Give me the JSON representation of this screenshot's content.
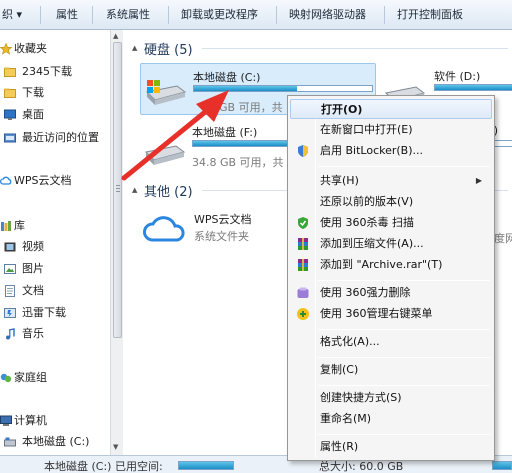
{
  "toolbar": {
    "items": [
      "织",
      "属性",
      "系统属性",
      "卸载或更改程序",
      "映射网络驱动器",
      "打开控制面板"
    ]
  },
  "nav": {
    "items": [
      {
        "label": "收藏夹",
        "icon": "star-icon"
      },
      {
        "label": "2345下载",
        "icon": "folder-icon"
      },
      {
        "label": "下载",
        "icon": "folder-icon"
      },
      {
        "label": "桌面",
        "icon": "desktop-icon"
      },
      {
        "label": "最近访问的位置",
        "icon": "recent-places-icon"
      },
      {
        "label": "WPS云文档",
        "icon": "cloud-icon"
      },
      {
        "label": "库",
        "icon": "library-icon"
      },
      {
        "label": "视频",
        "icon": "video-icon"
      },
      {
        "label": "图片",
        "icon": "picture-icon"
      },
      {
        "label": "文档",
        "icon": "document-icon"
      },
      {
        "label": "迅雷下载",
        "icon": "thunder-download-icon"
      },
      {
        "label": "音乐",
        "icon": "music-icon"
      },
      {
        "label": "家庭组",
        "icon": "homegroup-icon"
      },
      {
        "label": "计算机",
        "icon": "computer-icon"
      },
      {
        "label": "本地磁盘 (C:)",
        "icon": "drive-icon"
      }
    ]
  },
  "content": {
    "hdd_group": "硬盘 (5)",
    "other_group": "其他 (2)",
    "drives": [
      {
        "name": "本地磁盘 (C:)",
        "free_text": "GB 可用，共",
        "usage": 0.58
      },
      {
        "name": "软件 (D:)",
        "free_text": "",
        "usage": 0.9
      },
      {
        "name": "本地磁盘 (F:)",
        "free_text": "34.8 GB 可用，共",
        "usage": 0.62
      },
      {
        "name": ":)",
        "free_text": "",
        "usage": 0.5
      }
    ],
    "wps": {
      "name": "WPS云文档",
      "sub": "系统文件夹"
    },
    "right_cut_text": "度网"
  },
  "status": {
    "left": "本地磁盘 (C:) 已用空间:",
    "right": "总大小: 60.0 GB"
  },
  "context_menu": {
    "items": [
      {
        "label": "打开(O)",
        "bold": true,
        "highlighted": true,
        "icon": ""
      },
      {
        "label": "在新窗口中打开(E)",
        "icon": ""
      },
      {
        "label": "启用 BitLocker(B)...",
        "icon": "shield-icon"
      },
      {
        "label": "共享(H)",
        "submenu": true,
        "icon": ""
      },
      {
        "label": "还原以前的版本(V)",
        "icon": ""
      },
      {
        "label": "使用 360杀毒 扫描",
        "icon": "360-antivirus-icon"
      },
      {
        "label": "添加到压缩文件(A)...",
        "icon": "winrar-icon"
      },
      {
        "label": "添加到 \"Archive.rar\"(T)",
        "icon": "winrar-icon"
      },
      {
        "label": "使用 360强力删除",
        "icon": "360-delete-icon"
      },
      {
        "label": "使用 360管理右键菜单",
        "icon": "360-manager-icon"
      },
      {
        "label": "格式化(A)...",
        "icon": ""
      },
      {
        "label": "复制(C)",
        "icon": ""
      },
      {
        "label": "创建快捷方式(S)",
        "icon": ""
      },
      {
        "label": "重命名(M)",
        "icon": ""
      },
      {
        "label": "属性(R)",
        "icon": ""
      }
    ]
  },
  "colors": {
    "accent": "#1b8ec7",
    "arrow": "#e8302a",
    "menu_bg": "#f5f5f5",
    "selection": "#d9ecfb"
  }
}
